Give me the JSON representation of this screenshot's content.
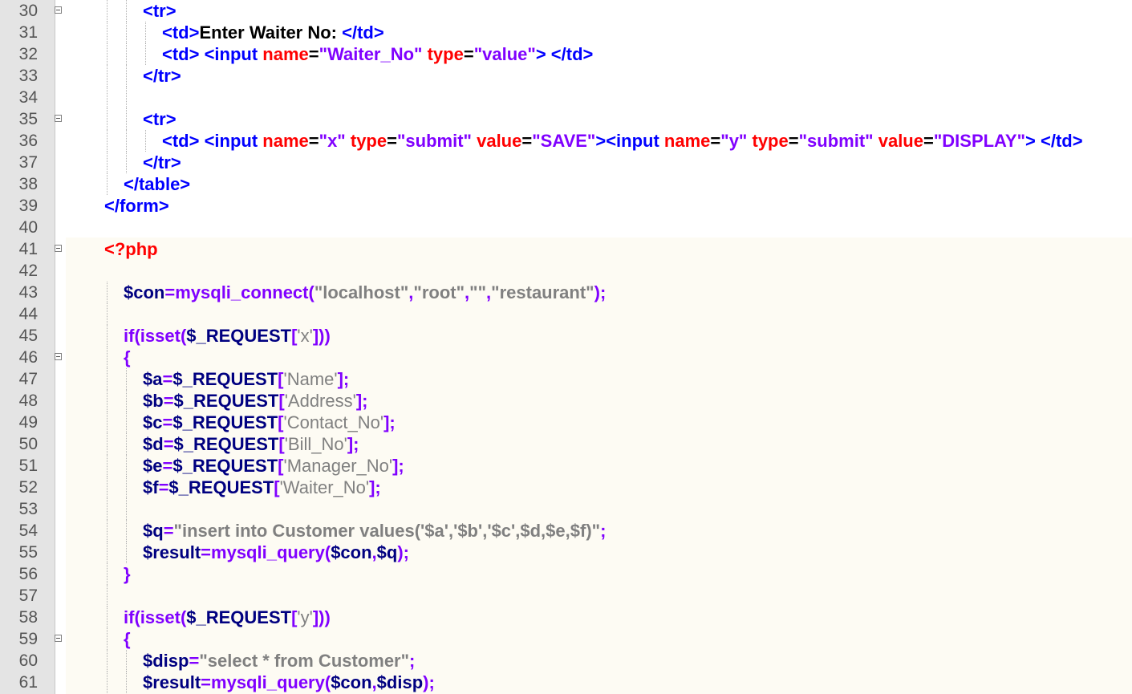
{
  "lines": [
    {
      "n": "30",
      "fold": true,
      "indent": 2,
      "tokens": [
        [
          "tag",
          "<tr>"
        ]
      ]
    },
    {
      "n": "31",
      "indent": 3,
      "tokens": [
        [
          "tag",
          "<td>"
        ],
        [
          "text",
          "Enter Waiter No: "
        ],
        [
          "tag",
          "</td>"
        ]
      ]
    },
    {
      "n": "32",
      "indent": 3,
      "tokens": [
        [
          "tag",
          "<td> <input "
        ],
        [
          "attr",
          "name"
        ],
        [
          "punct",
          "="
        ],
        [
          "str",
          "\"Waiter_No\""
        ],
        [
          "tag",
          " "
        ],
        [
          "attr",
          "type"
        ],
        [
          "punct",
          "="
        ],
        [
          "str",
          "\"value\""
        ],
        [
          "tag",
          "> </td>"
        ]
      ]
    },
    {
      "n": "33",
      "indent": 2,
      "tokens": [
        [
          "tag",
          "</tr>"
        ]
      ]
    },
    {
      "n": "34",
      "indent": 2,
      "tokens": []
    },
    {
      "n": "35",
      "fold": true,
      "indent": 2,
      "tokens": [
        [
          "tag",
          "<tr>"
        ]
      ]
    },
    {
      "n": "36",
      "indent": 3,
      "tokens": [
        [
          "tag",
          "<td> <input "
        ],
        [
          "attr",
          "name"
        ],
        [
          "punct",
          "="
        ],
        [
          "str",
          "\"x\""
        ],
        [
          "tag",
          " "
        ],
        [
          "attr",
          "type"
        ],
        [
          "punct",
          "="
        ],
        [
          "str",
          "\"submit\""
        ],
        [
          "tag",
          " "
        ],
        [
          "attr",
          "value"
        ],
        [
          "punct",
          "="
        ],
        [
          "str",
          "\"SAVE\""
        ],
        [
          "tag",
          "><input "
        ],
        [
          "attr",
          "name"
        ],
        [
          "punct",
          "="
        ],
        [
          "str",
          "\"y\""
        ],
        [
          "tag",
          " "
        ],
        [
          "attr",
          "type"
        ],
        [
          "punct",
          "="
        ],
        [
          "str",
          "\"submit\""
        ],
        [
          "tag",
          " "
        ],
        [
          "attr",
          "value"
        ],
        [
          "punct",
          "="
        ],
        [
          "str",
          "\"DISPLAY\""
        ],
        [
          "tag",
          "> </td>"
        ]
      ]
    },
    {
      "n": "37",
      "indent": 2,
      "tokens": [
        [
          "tag",
          "</tr>"
        ]
      ]
    },
    {
      "n": "38",
      "indent": 1,
      "tokens": [
        [
          "tag",
          "</table>"
        ]
      ]
    },
    {
      "n": "39",
      "indent": 0,
      "tokens": [
        [
          "tag",
          "</form>"
        ]
      ]
    },
    {
      "n": "40",
      "indent": 0,
      "tokens": []
    },
    {
      "n": "41",
      "fold": true,
      "indent": 0,
      "tokens": [
        [
          "php",
          "<?php"
        ]
      ]
    },
    {
      "n": "42",
      "indent": 0,
      "tokens": []
    },
    {
      "n": "43",
      "indent": 1,
      "tokens": [
        [
          "var",
          "$con"
        ],
        [
          "op",
          "="
        ],
        [
          "func",
          "mysqli_connect"
        ],
        [
          "op",
          "("
        ],
        [
          "dq",
          "\"localhost\""
        ],
        [
          "op",
          ","
        ],
        [
          "dq",
          "\"root\""
        ],
        [
          "op",
          ","
        ],
        [
          "dq",
          "\"\""
        ],
        [
          "op",
          ","
        ],
        [
          "dq",
          "\"restaurant\""
        ],
        [
          "op",
          ");"
        ]
      ]
    },
    {
      "n": "44",
      "indent": 1,
      "tokens": []
    },
    {
      "n": "45",
      "indent": 1,
      "tokens": [
        [
          "func",
          "if"
        ],
        [
          "op",
          "("
        ],
        [
          "func",
          "isset"
        ],
        [
          "op",
          "("
        ],
        [
          "var",
          "$_REQUEST"
        ],
        [
          "op",
          "["
        ],
        [
          "sq",
          "'x'"
        ],
        [
          "op",
          "]))"
        ]
      ]
    },
    {
      "n": "46",
      "fold": true,
      "indent": 1,
      "tokens": [
        [
          "op",
          "{"
        ]
      ]
    },
    {
      "n": "47",
      "indent": 2,
      "tokens": [
        [
          "var",
          "$a"
        ],
        [
          "op",
          "="
        ],
        [
          "var",
          "$_REQUEST"
        ],
        [
          "op",
          "["
        ],
        [
          "sq",
          "'Name'"
        ],
        [
          "op",
          "];"
        ]
      ]
    },
    {
      "n": "48",
      "indent": 2,
      "tokens": [
        [
          "var",
          "$b"
        ],
        [
          "op",
          "="
        ],
        [
          "var",
          "$_REQUEST"
        ],
        [
          "op",
          "["
        ],
        [
          "sq",
          "'Address'"
        ],
        [
          "op",
          "];"
        ]
      ]
    },
    {
      "n": "49",
      "indent": 2,
      "tokens": [
        [
          "var",
          "$c"
        ],
        [
          "op",
          "="
        ],
        [
          "var",
          "$_REQUEST"
        ],
        [
          "op",
          "["
        ],
        [
          "sq",
          "'Contact_No'"
        ],
        [
          "op",
          "];"
        ]
      ]
    },
    {
      "n": "50",
      "indent": 2,
      "tokens": [
        [
          "var",
          "$d"
        ],
        [
          "op",
          "="
        ],
        [
          "var",
          "$_REQUEST"
        ],
        [
          "op",
          "["
        ],
        [
          "sq",
          "'Bill_No'"
        ],
        [
          "op",
          "];"
        ]
      ]
    },
    {
      "n": "51",
      "indent": 2,
      "tokens": [
        [
          "var",
          "$e"
        ],
        [
          "op",
          "="
        ],
        [
          "var",
          "$_REQUEST"
        ],
        [
          "op",
          "["
        ],
        [
          "sq",
          "'Manager_No'"
        ],
        [
          "op",
          "];"
        ]
      ]
    },
    {
      "n": "52",
      "indent": 2,
      "tokens": [
        [
          "var",
          "$f"
        ],
        [
          "op",
          "="
        ],
        [
          "var",
          "$_REQUEST"
        ],
        [
          "op",
          "["
        ],
        [
          "sq",
          "'Waiter_No'"
        ],
        [
          "op",
          "];"
        ]
      ]
    },
    {
      "n": "53",
      "indent": 2,
      "tokens": []
    },
    {
      "n": "54",
      "indent": 2,
      "tokens": [
        [
          "var",
          "$q"
        ],
        [
          "op",
          "="
        ],
        [
          "dq",
          "\"insert into Customer values('$a','$b','$c',$d,$e,$f)\""
        ],
        [
          "op",
          ";"
        ]
      ]
    },
    {
      "n": "55",
      "indent": 2,
      "tokens": [
        [
          "var",
          "$result"
        ],
        [
          "op",
          "="
        ],
        [
          "func",
          "mysqli_query"
        ],
        [
          "op",
          "("
        ],
        [
          "var",
          "$con"
        ],
        [
          "op",
          ","
        ],
        [
          "var",
          "$q"
        ],
        [
          "op",
          ");"
        ]
      ]
    },
    {
      "n": "56",
      "indent": 1,
      "tokens": [
        [
          "op",
          "}"
        ]
      ]
    },
    {
      "n": "57",
      "indent": 1,
      "tokens": []
    },
    {
      "n": "58",
      "indent": 1,
      "tokens": [
        [
          "func",
          "if"
        ],
        [
          "op",
          "("
        ],
        [
          "func",
          "isset"
        ],
        [
          "op",
          "("
        ],
        [
          "var",
          "$_REQUEST"
        ],
        [
          "op",
          "["
        ],
        [
          "sq",
          "'y'"
        ],
        [
          "op",
          "]))"
        ]
      ]
    },
    {
      "n": "59",
      "fold": true,
      "indent": 1,
      "tokens": [
        [
          "op",
          "{"
        ]
      ]
    },
    {
      "n": "60",
      "indent": 2,
      "tokens": [
        [
          "var",
          "$disp"
        ],
        [
          "op",
          "="
        ],
        [
          "dq",
          "\"select * from Customer\""
        ],
        [
          "op",
          ";"
        ]
      ]
    },
    {
      "n": "61",
      "indent": 2,
      "tokens": [
        [
          "var",
          "$result"
        ],
        [
          "op",
          "="
        ],
        [
          "func",
          "mysqli_query"
        ],
        [
          "op",
          "("
        ],
        [
          "var",
          "$con"
        ],
        [
          "op",
          ","
        ],
        [
          "var",
          "$disp"
        ],
        [
          "op",
          ");"
        ]
      ]
    }
  ]
}
